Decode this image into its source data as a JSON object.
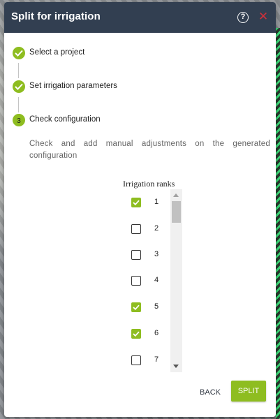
{
  "dialog": {
    "title": "Split for irrigation",
    "help_icon": "help-circle-icon",
    "close_icon": "close-icon",
    "accent_color": "#8ebd20",
    "header_color": "#323f51",
    "close_color": "#d0303a"
  },
  "steps": [
    {
      "label": "Select a project",
      "state": "completed",
      "icon": "checkmark-icon"
    },
    {
      "label": "Set irrigation parameters",
      "state": "completed",
      "icon": "checkmark-icon"
    },
    {
      "label": "Check configuration",
      "state": "active",
      "number": "3"
    }
  ],
  "description": "Check and add manual adjustments on the generated configuration",
  "ranks": {
    "title": "Irrigation ranks",
    "items": [
      {
        "label": "1",
        "checked": true
      },
      {
        "label": "2",
        "checked": false
      },
      {
        "label": "3",
        "checked": false
      },
      {
        "label": "4",
        "checked": false
      },
      {
        "label": "5",
        "checked": true
      },
      {
        "label": "6",
        "checked": true
      },
      {
        "label": "7",
        "checked": false
      }
    ]
  },
  "buttons": {
    "back": "BACK",
    "split": "SPLIT"
  }
}
